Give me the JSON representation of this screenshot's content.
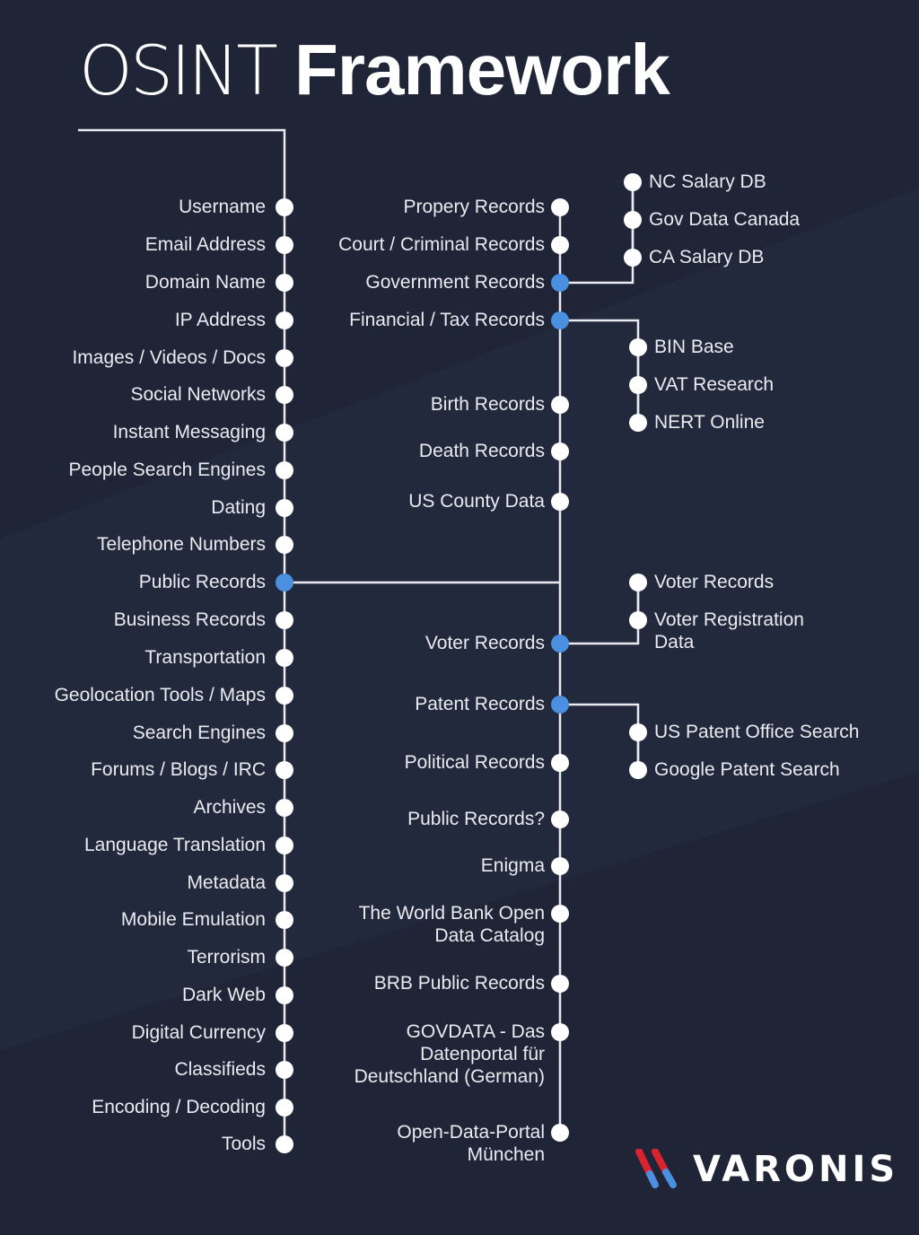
{
  "title": {
    "light": "OSINT",
    "bold": "Framework"
  },
  "colors": {
    "background": "#1f2436",
    "accent": "#4a8fe0",
    "node": "#ffffff",
    "line": "#e9ebf0",
    "logo_red": "#d9232e",
    "logo_blue": "#4a8fe0"
  },
  "left_column": [
    {
      "label": "Username"
    },
    {
      "label": "Email Address"
    },
    {
      "label": "Domain Name"
    },
    {
      "label": "IP Address"
    },
    {
      "label": "Images / Videos / Docs"
    },
    {
      "label": "Social Networks"
    },
    {
      "label": "Instant Messaging"
    },
    {
      "label": "People Search Engines"
    },
    {
      "label": "Dating"
    },
    {
      "label": "Telephone Numbers"
    },
    {
      "label": "Public Records",
      "active": true
    },
    {
      "label": "Business Records"
    },
    {
      "label": "Transportation"
    },
    {
      "label": "Geolocation Tools / Maps"
    },
    {
      "label": "Search Engines"
    },
    {
      "label": "Forums / Blogs / IRC"
    },
    {
      "label": "Archives"
    },
    {
      "label": "Language Translation"
    },
    {
      "label": "Metadata"
    },
    {
      "label": "Mobile Emulation"
    },
    {
      "label": "Terrorism"
    },
    {
      "label": "Dark Web"
    },
    {
      "label": "Digital Currency"
    },
    {
      "label": "Classifieds"
    },
    {
      "label": "Encoding / Decoding"
    },
    {
      "label": "Tools"
    }
  ],
  "center_column": [
    {
      "label": "Propery Records"
    },
    {
      "label": "Court / Criminal Records"
    },
    {
      "label": "Government Records",
      "active": true
    },
    {
      "label": "Financial / Tax Records",
      "active": true
    },
    {
      "label": "Birth Records"
    },
    {
      "label": "Death Records"
    },
    {
      "label": "US County Data"
    },
    {
      "label": "Voter Records",
      "active": true
    },
    {
      "label": "Patent Records",
      "active": true
    },
    {
      "label": "Political Records"
    },
    {
      "label": "Public Records?"
    },
    {
      "label": "Enigma"
    },
    {
      "label": "The World Bank Open\nData Catalog"
    },
    {
      "label": "BRB Public Records"
    },
    {
      "label": "GOVDATA - Das\nDatenportal für\nDeutschland (German)"
    },
    {
      "label": "Open-Data-Portal\nMünchen"
    }
  ],
  "branches": {
    "government_records": [
      "NC Salary DB",
      "Gov Data Canada",
      "CA Salary DB"
    ],
    "financial_tax_records": [
      "BIN Base",
      "VAT Research",
      "NERT Online"
    ],
    "voter_records": [
      "Voter Records",
      "Voter Registration\nData"
    ],
    "patent_records": [
      "US Patent Office Search",
      "Google Patent Search"
    ]
  },
  "logo": {
    "text": "VARONIS",
    "icon": "varonis-chevron-icon"
  }
}
